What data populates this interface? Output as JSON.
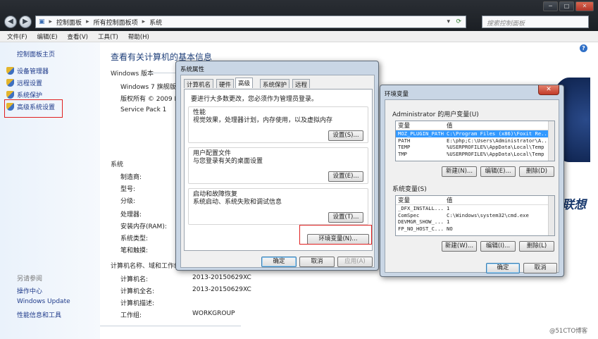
{
  "explorer": {
    "breadcrumbs": [
      "控制面板",
      "所有控制面板项",
      "系统"
    ],
    "search_placeholder": "搜索控制面板",
    "window_buttons": [
      "─",
      "□",
      "✕"
    ]
  },
  "menu": [
    "文件(F)",
    "编辑(E)",
    "查看(V)",
    "工具(T)",
    "帮助(H)"
  ],
  "sidebar": {
    "home": "控制面板主页",
    "items": [
      "设备管理器",
      "远程设置",
      "系统保护",
      "高级系统设置"
    ],
    "see_also": "另请参阅",
    "links": [
      "操作中心",
      "Windows Update",
      "性能信息和工具"
    ]
  },
  "main": {
    "title": "查看有关计算机的基本信息",
    "edition_header": "Windows 版本",
    "edition": "Windows 7 旗舰版",
    "copyright": "版权所有 © 2009 Mi",
    "service_pack": "Service Pack 1",
    "system_header": "系统",
    "system_labels": [
      "制造商:",
      "型号:",
      "分级:",
      "处理器:",
      "安装内存(RAM):",
      "系统类型:",
      "笔和触摸:"
    ],
    "computer_header": "计算机名称、域和工作组设",
    "computer_labels": [
      "计算机名:",
      "计算机全名:",
      "计算机描述:",
      "工作组:"
    ],
    "computer_values": [
      "2013-20150629XC",
      "2013-20150629XC",
      "",
      "WORKGROUP"
    ]
  },
  "logo_text": "联想",
  "watermark": "@51CTO博客",
  "sysprops": {
    "title": "系统属性",
    "tabs": [
      "计算机名",
      "硬件",
      "高级",
      "系统保护",
      "远程"
    ],
    "selected_tab": "高级",
    "admin_note": "要进行大多数更改，您必须作为管理员登录。",
    "perf_title": "性能",
    "perf_desc": "视觉效果，处理器计划，内存使用，以及虚拟内存",
    "perf_button": "设置(S)...",
    "profile_title": "用户配置文件",
    "profile_desc": "与您登录有关的桌面设置",
    "profile_button": "设置(E)...",
    "startup_title": "启动和故障恢复",
    "startup_desc": "系统启动、系统失败和调试信息",
    "startup_button": "设置(T)...",
    "env_button": "环境变量(N)...",
    "ok": "确定",
    "cancel": "取消",
    "apply": "应用(A)"
  },
  "envvars": {
    "title": "环境变量",
    "user_group": "Administrator 的用户变量(U)",
    "col_var": "变量",
    "col_val": "值",
    "user_vars": [
      {
        "name": "MOZ_PLUGIN_PATH",
        "value": "C:\\Program Files (x86)\\Foxit Re..."
      },
      {
        "name": "PATH",
        "value": "E:\\php;C:\\Users\\Administrator\\A..."
      },
      {
        "name": "TEMP",
        "value": "%USERPROFILE%\\AppData\\Local\\Temp"
      },
      {
        "name": "TMP",
        "value": "%USERPROFILE%\\AppData\\Local\\Temp"
      }
    ],
    "user_buttons": [
      "新建(N)...",
      "编辑(E)...",
      "删除(D)"
    ],
    "sys_group": "系统变量(S)",
    "sys_vars": [
      {
        "name": "_DFX_INSTALL...",
        "value": "1"
      },
      {
        "name": "ComSpec",
        "value": "C:\\Windows\\system32\\cmd.exe"
      },
      {
        "name": "DEVMGR_SHOW_...",
        "value": "1"
      },
      {
        "name": "FP_NO_HOST_C...",
        "value": "NO"
      }
    ],
    "sys_buttons": [
      "新建(W)...",
      "编辑(I)...",
      "删除(L)"
    ],
    "ok": "确定",
    "cancel": "取消"
  }
}
